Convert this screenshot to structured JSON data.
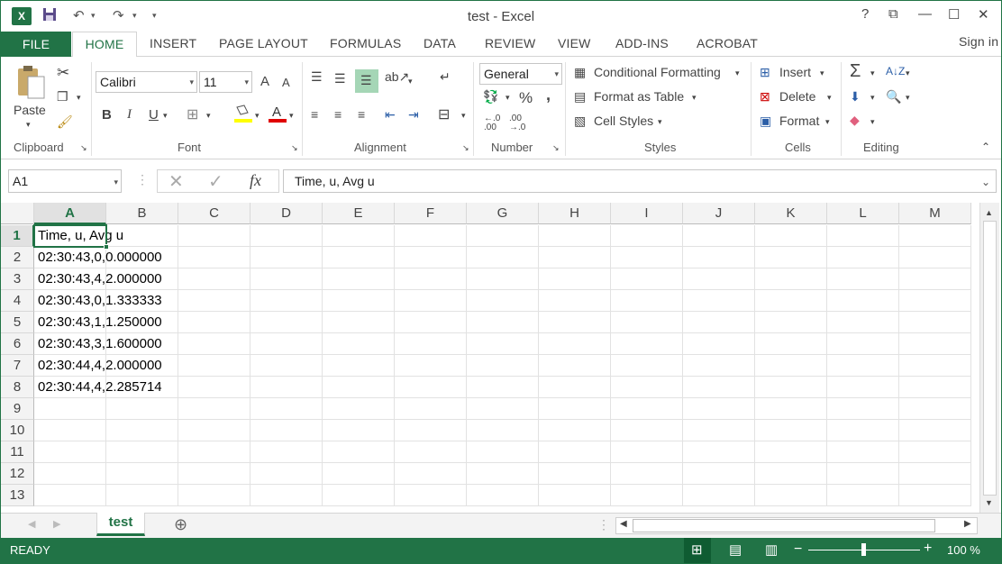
{
  "window": {
    "title": "test - Excel",
    "help": "?",
    "restore_ribbon": "⧉",
    "minimize": "—",
    "maximize": "☐",
    "close": "✕"
  },
  "qat": {
    "logo": "X",
    "undo": "↶",
    "redo": "↷",
    "customize": "⏷"
  },
  "tabs": {
    "file": "FILE",
    "items": [
      "HOME",
      "INSERT",
      "PAGE LAYOUT",
      "FORMULAS",
      "DATA",
      "REVIEW",
      "VIEW",
      "ADD-INS",
      "ACROBAT"
    ],
    "sign_in": "Sign in"
  },
  "ribbon": {
    "clipboard": {
      "label": "Clipboard",
      "paste": "Paste"
    },
    "font": {
      "label": "Font",
      "name": "Calibri",
      "size": "11",
      "bold": "B",
      "italic": "I",
      "underline": "U",
      "grow": "A",
      "shrink": "A"
    },
    "alignment": {
      "label": "Alignment"
    },
    "number": {
      "label": "Number",
      "format": "General",
      "percent": "%",
      "comma": ","
    },
    "styles": {
      "label": "Styles",
      "conditional": "Conditional Formatting",
      "table": "Format as Table",
      "cell_styles": "Cell Styles"
    },
    "cells": {
      "label": "Cells",
      "insert": "Insert",
      "delete": "Delete",
      "format": "Format"
    },
    "editing": {
      "label": "Editing",
      "sum": "Σ"
    }
  },
  "formula_bar": {
    "name_box": "A1",
    "fx": "fx",
    "value": "Time, u, Avg u"
  },
  "sheet": {
    "columns": [
      "A",
      "B",
      "C",
      "D",
      "E",
      "F",
      "G",
      "H",
      "I",
      "J",
      "K",
      "L",
      "M"
    ],
    "rows": [
      "1",
      "2",
      "3",
      "4",
      "5",
      "6",
      "7",
      "8",
      "9",
      "10",
      "11",
      "12",
      "13"
    ],
    "cells": [
      "Time, u, Avg u",
      "02:30:43,0,0.000000",
      "02:30:43,4,2.000000",
      "02:30:43,0,1.333333",
      "02:30:43,1,1.250000",
      "02:30:43,3,1.600000",
      "02:30:44,4,2.000000",
      "02:30:44,4,2.285714",
      "",
      "",
      "",
      "",
      ""
    ],
    "selected_cell": "A1"
  },
  "sheet_tabs": {
    "active": "test",
    "add": "⊕"
  },
  "status": {
    "ready": "READY",
    "zoom": "100 %",
    "zoom_minus": "−",
    "zoom_plus": "+"
  },
  "colors": {
    "accent": "#217346",
    "header_bg": "#f3f3f3",
    "select": "#217346"
  }
}
